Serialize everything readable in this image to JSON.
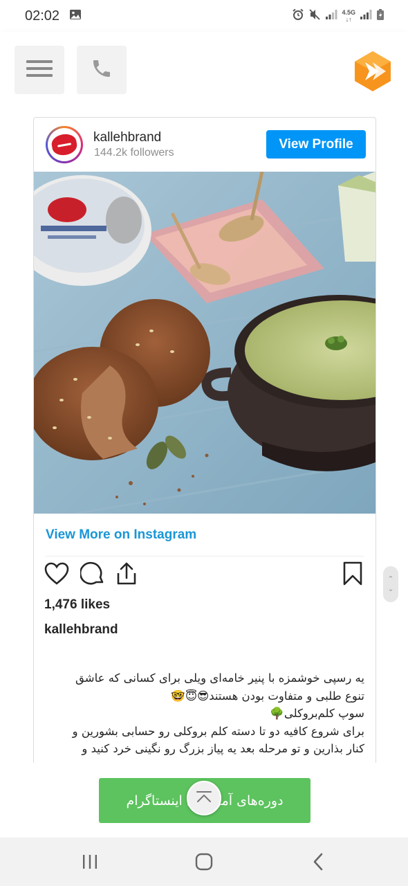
{
  "status_bar": {
    "time": "02:02",
    "network_label": "4.5G",
    "icons": [
      "gallery-icon",
      "alarm-icon",
      "mute-icon",
      "signal-icon",
      "battery-icon"
    ]
  },
  "header": {
    "menu_icon": "hamburger-icon",
    "phone_icon": "phone-icon",
    "brand_colors": {
      "orange": "#f7941d",
      "dark_orange": "#e07b0a"
    }
  },
  "instagram": {
    "username": "kallehbrand",
    "followers": "144.2k followers",
    "view_profile_label": "View Profile",
    "view_more_label": "View More on Instagram",
    "likes": "1,476 likes",
    "caption_user": "kallehbrand",
    "caption_lines": [
      "یه رسپی خوشمزه با پنیر خامه‌ای ویلی برای کسانی که عاشق",
      "تنوع طلبی و متفاوت بودن هستند😎😇🤓",
      "سوپ کلم‌بروکلی🌳",
      "برای شروع کافیه دو تا دسته کلم بروکلی رو حسابی بشورین و",
      "کنار بذارین و تو مرحله بعد یه پیاز بزرگ رو نگینی خرد کنید و"
    ],
    "accent_color": "#0095f6",
    "link_color": "#1a96d6"
  },
  "cta": {
    "label": "دوره‌های آموزشی اینستاگرام",
    "color": "#5cc35e"
  },
  "scroll": {
    "up_glyph": "⌃",
    "down_glyph": "⌄"
  }
}
